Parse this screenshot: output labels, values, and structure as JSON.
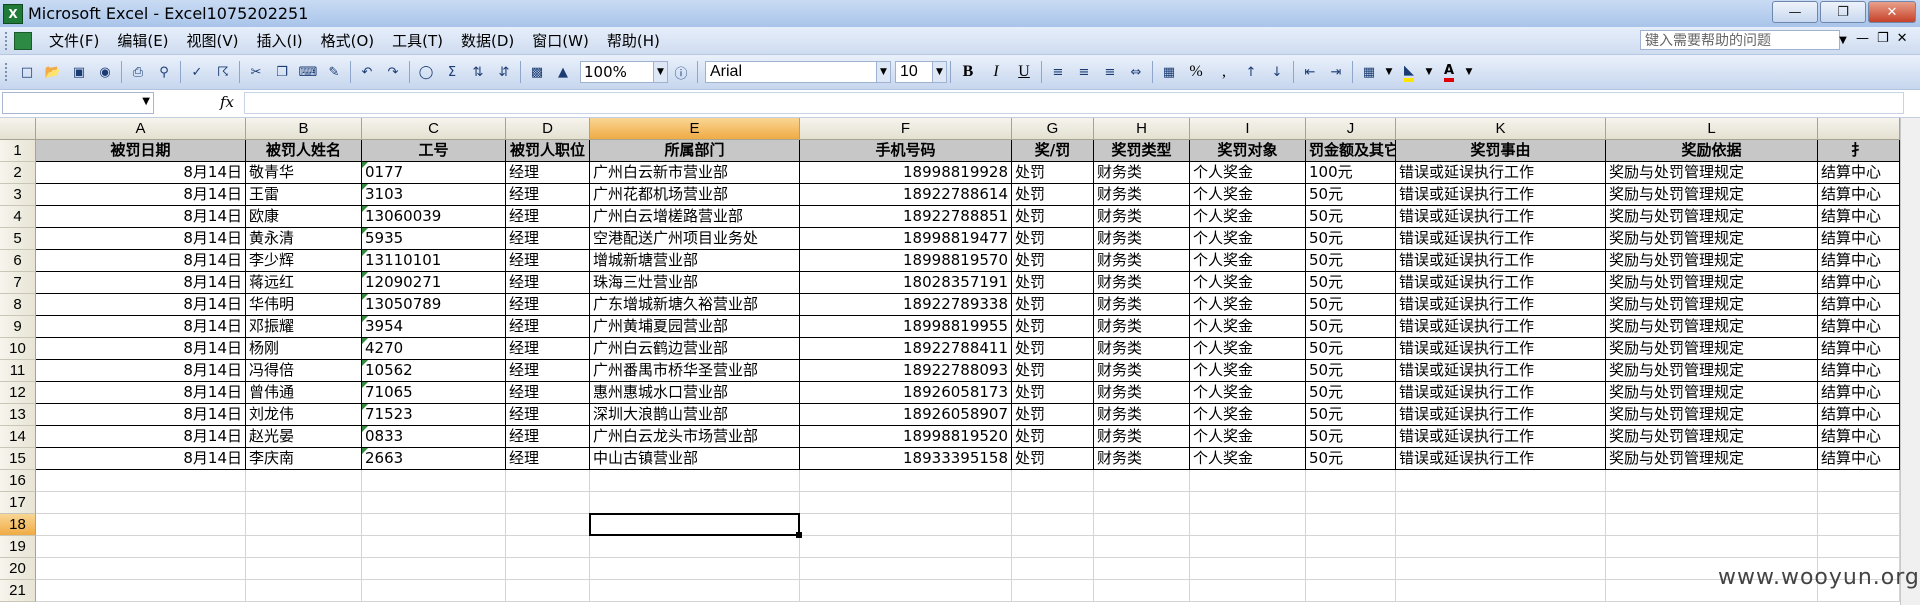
{
  "window": {
    "title": "Microsoft Excel - Excel1075202251",
    "app_icon": "X"
  },
  "menu": {
    "items": [
      "文件(F)",
      "编辑(E)",
      "视图(V)",
      "插入(I)",
      "格式(O)",
      "工具(T)",
      "数据(D)",
      "窗口(W)",
      "帮助(H)"
    ],
    "help_placeholder": "键入需要帮助的问题"
  },
  "toolbar": {
    "zoom": "100%",
    "font": "Arial",
    "size": "10",
    "bold": "B",
    "italic": "I",
    "underline": "U",
    "percent": "%",
    "comma": ","
  },
  "formula": {
    "fx": "fx"
  },
  "sheet": {
    "columns": [
      "A",
      "B",
      "C",
      "D",
      "E",
      "F",
      "G",
      "H",
      "I",
      "J",
      "K",
      "L"
    ],
    "rows": [
      "1",
      "2",
      "3",
      "4",
      "5",
      "6",
      "7",
      "8",
      "9",
      "10",
      "11",
      "12",
      "13",
      "14",
      "15",
      "16",
      "17",
      "18",
      "19",
      "20",
      "21"
    ],
    "headers": [
      "被罚日期",
      "被罚人姓名",
      "工号",
      "被罚人职位",
      "所属部门",
      "手机号码",
      "奖/罚",
      "奖罚类型",
      "奖罚对象",
      "罚金额及其它",
      "奖罚事由",
      "奖励依据",
      "扌"
    ],
    "data": [
      [
        "8月14日",
        "敬青华",
        "0177",
        "经理",
        "广州白云新市营业部",
        "18998819928",
        "处罚",
        "财务类",
        "个人奖金",
        "100元",
        "错误或延误执行工作",
        "奖励与处罚管理规定",
        "结算中心"
      ],
      [
        "8月14日",
        "王雷",
        "3103",
        "经理",
        "广州花都机场营业部",
        "18922788614",
        "处罚",
        "财务类",
        "个人奖金",
        "50元",
        "错误或延误执行工作",
        "奖励与处罚管理规定",
        "结算中心"
      ],
      [
        "8月14日",
        "欧康",
        "13060039",
        "经理",
        "广州白云增槎路营业部",
        "18922788851",
        "处罚",
        "财务类",
        "个人奖金",
        "50元",
        "错误或延误执行工作",
        "奖励与处罚管理规定",
        "结算中心"
      ],
      [
        "8月14日",
        "黄永清",
        "5935",
        "经理",
        "空港配送广州项目业务处",
        "18998819477",
        "处罚",
        "财务类",
        "个人奖金",
        "50元",
        "错误或延误执行工作",
        "奖励与处罚管理规定",
        "结算中心"
      ],
      [
        "8月14日",
        "李少辉",
        "13110101",
        "经理",
        "增城新塘营业部",
        "18998819570",
        "处罚",
        "财务类",
        "个人奖金",
        "50元",
        "错误或延误执行工作",
        "奖励与处罚管理规定",
        "结算中心"
      ],
      [
        "8月14日",
        "蒋远红",
        "12090271",
        "经理",
        "珠海三灶营业部",
        "18028357191",
        "处罚",
        "财务类",
        "个人奖金",
        "50元",
        "错误或延误执行工作",
        "奖励与处罚管理规定",
        "结算中心"
      ],
      [
        "8月14日",
        "华伟明",
        "13050789",
        "经理",
        "广东增城新塘久裕营业部",
        "18922789338",
        "处罚",
        "财务类",
        "个人奖金",
        "50元",
        "错误或延误执行工作",
        "奖励与处罚管理规定",
        "结算中心"
      ],
      [
        "8月14日",
        "邓振耀",
        "3954",
        "经理",
        "广州黄埔夏园营业部",
        "18998819955",
        "处罚",
        "财务类",
        "个人奖金",
        "50元",
        "错误或延误执行工作",
        "奖励与处罚管理规定",
        "结算中心"
      ],
      [
        "8月14日",
        "杨刚",
        "4270",
        "经理",
        "广州白云鹤边营业部",
        "18922788411",
        "处罚",
        "财务类",
        "个人奖金",
        "50元",
        "错误或延误执行工作",
        "奖励与处罚管理规定",
        "结算中心"
      ],
      [
        "8月14日",
        "冯得倍",
        "10562",
        "经理",
        "广州番禺市桥华圣营业部",
        "18922788093",
        "处罚",
        "财务类",
        "个人奖金",
        "50元",
        "错误或延误执行工作",
        "奖励与处罚管理规定",
        "结算中心"
      ],
      [
        "8月14日",
        "曾伟通",
        "71065",
        "经理",
        "惠州惠城水口营业部",
        "18926058173",
        "处罚",
        "财务类",
        "个人奖金",
        "50元",
        "错误或延误执行工作",
        "奖励与处罚管理规定",
        "结算中心"
      ],
      [
        "8月14日",
        "刘龙伟",
        "71523",
        "经理",
        "深圳大浪鹊山营业部",
        "18926058907",
        "处罚",
        "财务类",
        "个人奖金",
        "50元",
        "错误或延误执行工作",
        "奖励与处罚管理规定",
        "结算中心"
      ],
      [
        "8月14日",
        "赵光晏",
        "0833",
        "经理",
        "广州白云龙头市场营业部",
        "18998819520",
        "处罚",
        "财务类",
        "个人奖金",
        "50元",
        "错误或延误执行工作",
        "奖励与处罚管理规定",
        "结算中心"
      ],
      [
        "8月14日",
        "李庆南",
        "2663",
        "经理",
        "中山古镇营业部",
        "18933395158",
        "处罚",
        "财务类",
        "个人奖金",
        "50元",
        "错误或延误执行工作",
        "奖励与处罚管理规定",
        "结算中心"
      ]
    ]
  },
  "watermark": "www.wooyun.org"
}
